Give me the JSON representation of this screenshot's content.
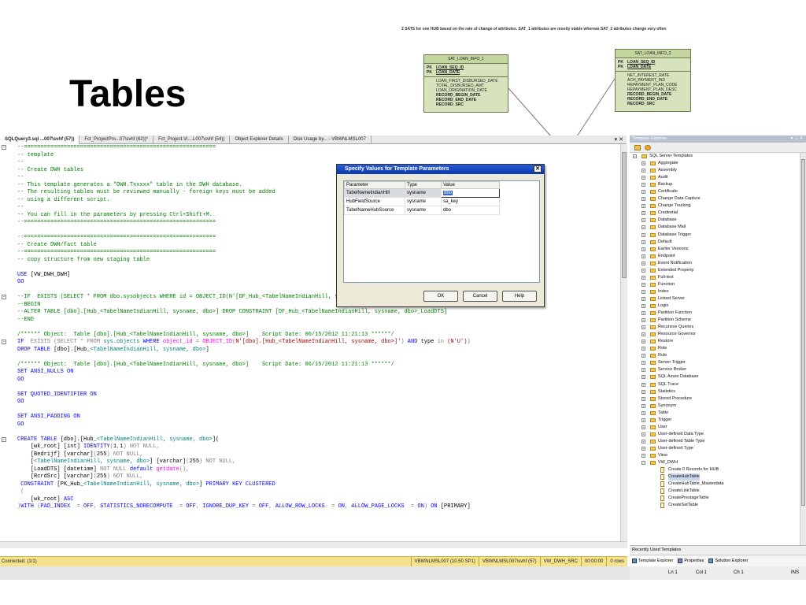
{
  "slide": {
    "title": "Tables",
    "note": "2 SATS for one HUB based on the rate of change of attributes. SAT_1 attributes are mostly stable whereas SAT_2 attributes change very often"
  },
  "entities": [
    {
      "name": "SAT_LOAN_INFO_1",
      "keys": [
        {
          "pk": "PK",
          "col": "LOAN_SEQ_ID"
        },
        {
          "pk": "PK",
          "col": "LOAN_DATE"
        }
      ],
      "cols": [
        "LOAN_FIRST_DISBURSED_DATE",
        "TOTAL_DISBURSED_AMT",
        "LOAN_ORIGINATION_DATE"
      ],
      "bold_cols": [
        "RECORD_BEGIN_DATE",
        "RECORD_END_DATE",
        "RECORD_SRC"
      ]
    },
    {
      "name": "SAT_LOAN_INFO_2",
      "keys": [
        {
          "pk": "PK",
          "col": "LOAN_SEQ_ID"
        },
        {
          "pk": "PK",
          "col": "LOAN_DATE"
        }
      ],
      "cols": [
        "NET_INTEREST_RATE",
        "ACH_PAYMENT_IND",
        "REPAYMENT_PLAN_CODE",
        "REPAYMENT_PLAN_DESC"
      ],
      "bold_cols": [
        "RECORD_BEGIN_DATE",
        "RECORD_END_DATE",
        "RECORD_SRC"
      ]
    }
  ],
  "tabs": [
    "SQLQuery3.sql ...007\\svhf (57))",
    "Fct_ProjectPro...07\\svhf (62))*",
    "Fct_Project.Vi....L007\\svhf (54))",
    "Object Explorer Details",
    "Disk Usage by... - VBWNLMSL007"
  ],
  "tabbar_ctrl": "▾ ✕",
  "code": [
    {
      "m": "⊟",
      "segs": [
        [
          "g",
          "--=========================================================="
        ]
      ]
    },
    {
      "segs": [
        [
          "g",
          "-- template"
        ]
      ]
    },
    {
      "segs": [
        [
          "g",
          "--"
        ]
      ]
    },
    {
      "segs": [
        [
          "g",
          "-- Create DWH tables"
        ]
      ]
    },
    {
      "segs": [
        [
          "g",
          "--"
        ]
      ]
    },
    {
      "segs": [
        [
          "g",
          "-- This template generates a \"DWH.Txxxxx\" table in the DWH database."
        ]
      ]
    },
    {
      "segs": [
        [
          "g",
          "-- The resulting tables must be reviewed manually - foreign keys must be added"
        ]
      ]
    },
    {
      "segs": [
        [
          "g",
          "-- using a different script."
        ]
      ]
    },
    {
      "segs": [
        [
          "g",
          "--"
        ]
      ]
    },
    {
      "segs": [
        [
          "g",
          "-- You can fill in the parameters by pressing Ctrl+Shift+M."
        ]
      ]
    },
    {
      "segs": [
        [
          "g",
          "--=========================================================="
        ]
      ]
    },
    {
      "segs": [
        [
          "k",
          ""
        ]
      ]
    },
    {
      "segs": [
        [
          "g",
          "--=========================================================="
        ]
      ]
    },
    {
      "segs": [
        [
          "g",
          "-- Create DWH/fact table"
        ]
      ]
    },
    {
      "segs": [
        [
          "g",
          "--=========================================================="
        ]
      ]
    },
    {
      "segs": [
        [
          "g",
          "-- copy structure from new staging table"
        ]
      ]
    },
    {
      "segs": [
        [
          "k",
          ""
        ]
      ]
    },
    {
      "segs": [
        [
          "b",
          "USE "
        ],
        [
          "k",
          "[VW_DWH_DWH]"
        ]
      ]
    },
    {
      "segs": [
        [
          "b",
          "GO"
        ]
      ]
    },
    {
      "segs": [
        [
          "k",
          ""
        ]
      ]
    },
    {
      "m": "⊟",
      "segs": [
        [
          "g",
          "--IF  EXISTS (SELECT * FROM dbo.sysobjects WHERE id = OBJECT_ID(N'[DF_Hub_<TabelNameIndianHill, sysname, dbo>_LoadDTS]') AND type = 'D')"
        ]
      ]
    },
    {
      "segs": [
        [
          "g",
          "--BEGIN"
        ]
      ]
    },
    {
      "segs": [
        [
          "g",
          "--ALTER TABLE [dbo].[Hub_<TabelNameIndianHill, sysname, dbo>] DROP CONSTRAINT [DF_Hub_<TabelNameIndianHill, sysname, dbo>_LoadDTS]"
        ]
      ]
    },
    {
      "segs": [
        [
          "g",
          "--END"
        ]
      ]
    },
    {
      "segs": [
        [
          "k",
          ""
        ]
      ]
    },
    {
      "segs": [
        [
          "g",
          "/****** Object:  Table [dbo].[Hub_<TabelNameIndianHill, sysname, dbo>]    Script Date: 06/15/2012 11:21:13 ******/"
        ]
      ]
    },
    {
      "m": "⊟",
      "segs": [
        [
          "b",
          "IF  "
        ],
        [
          "x",
          "EXISTS "
        ],
        [
          "x",
          "(SELECT * FROM "
        ],
        [
          "t",
          "sys.objects "
        ],
        [
          "b",
          "WHERE "
        ],
        [
          "m",
          "object_id "
        ],
        [
          "x",
          "= "
        ],
        [
          "m",
          "OBJECT_ID"
        ],
        [
          "x",
          "("
        ],
        [
          "r",
          "N'[dbo].[Hub_<TabelNameIndianHill, sysname, dbo>]'"
        ],
        [
          "x",
          ") "
        ],
        [
          "b",
          "AND "
        ],
        [
          "k",
          "type "
        ],
        [
          "x",
          "in "
        ],
        [
          "r",
          "(N'U')"
        ],
        [
          "x",
          ")"
        ]
      ]
    },
    {
      "segs": [
        [
          "b",
          "DROP TABLE "
        ],
        [
          "k",
          "[dbo].[Hub_"
        ],
        [
          "t",
          "<TabelNameIndianHill, sysname, dbo>"
        ],
        [
          "k",
          "]"
        ]
      ]
    },
    {
      "segs": [
        [
          "k",
          ""
        ]
      ]
    },
    {
      "segs": [
        [
          "g",
          "/****** Object:  Table [dbo].[Hub_<TabelNameIndianHill, sysname, dbo>]    Script Date: 06/15/2012 11:21:13 ******/"
        ]
      ]
    },
    {
      "segs": [
        [
          "b",
          "SET ANSI_NULLS ON"
        ]
      ]
    },
    {
      "segs": [
        [
          "b",
          "GO"
        ]
      ]
    },
    {
      "segs": [
        [
          "k",
          ""
        ]
      ]
    },
    {
      "segs": [
        [
          "b",
          "SET QUOTED_IDENTIFIER ON"
        ]
      ]
    },
    {
      "segs": [
        [
          "b",
          "GO"
        ]
      ]
    },
    {
      "segs": [
        [
          "k",
          ""
        ]
      ]
    },
    {
      "segs": [
        [
          "b",
          "SET ANSI_PADDING ON"
        ]
      ]
    },
    {
      "segs": [
        [
          "b",
          "GO"
        ]
      ]
    },
    {
      "segs": [
        [
          "k",
          ""
        ]
      ]
    },
    {
      "m": "⊟",
      "segs": [
        [
          "b",
          "CREATE TABLE "
        ],
        [
          "k",
          "[dbo].[Hub_"
        ],
        [
          "t",
          "<TabelNameIndianHill, sysname, dbo>"
        ],
        [
          "k",
          "]("
        ]
      ]
    },
    {
      "segs": [
        [
          "k",
          "    [wk_root] "
        ],
        [
          "k",
          "[int] "
        ],
        [
          "b",
          "IDENTITY"
        ],
        [
          "x",
          "("
        ],
        [
          "k",
          "1"
        ],
        [
          "x",
          ","
        ],
        [
          "k",
          "1"
        ],
        [
          "x",
          ") NOT NULL,"
        ]
      ]
    },
    {
      "segs": [
        [
          "k",
          "    [Bedrijf] "
        ],
        [
          "k",
          "[varchar]"
        ],
        [
          "x",
          "("
        ],
        [
          "k",
          "255"
        ],
        [
          "x",
          ") NOT NULL,"
        ]
      ]
    },
    {
      "segs": [
        [
          "k",
          "    ["
        ],
        [
          "t",
          "<TabelNameIndianHill, sysname, dbo>"
        ],
        [
          "k",
          "] [varchar]"
        ],
        [
          "x",
          "("
        ],
        [
          "k",
          "255"
        ],
        [
          "x",
          ") NOT NULL,"
        ]
      ]
    },
    {
      "segs": [
        [
          "k",
          "    [LoadDTS] [datetime] "
        ],
        [
          "x",
          "NOT NULL "
        ],
        [
          "b",
          "default "
        ],
        [
          "m",
          "getdate"
        ],
        [
          "x",
          "(),"
        ]
      ]
    },
    {
      "segs": [
        [
          "k",
          "    [RcrdSrc] [varchar]"
        ],
        [
          "x",
          "("
        ],
        [
          "k",
          "255"
        ],
        [
          "x",
          ") NOT NULL,"
        ]
      ]
    },
    {
      "segs": [
        [
          "b",
          " CONSTRAINT "
        ],
        [
          "k",
          "[PK_Hub_"
        ],
        [
          "t",
          "<TabelNameIndianHill, sysname, dbo>"
        ],
        [
          "k",
          "] "
        ],
        [
          "b",
          "PRIMARY KEY CLUSTERED"
        ]
      ]
    },
    {
      "segs": [
        [
          "x",
          " ("
        ]
      ]
    },
    {
      "segs": [
        [
          "k",
          "    [wk_root] "
        ],
        [
          "b",
          "ASC"
        ]
      ]
    },
    {
      "segs": [
        [
          "x",
          ")"
        ],
        [
          "b",
          "WITH "
        ],
        [
          "x",
          "("
        ],
        [
          "b",
          "PAD_INDEX  "
        ],
        [
          "x",
          "= "
        ],
        [
          "b",
          "OFF"
        ],
        [
          "x",
          ", "
        ],
        [
          "b",
          "STATISTICS_NORECOMPUTE  "
        ],
        [
          "x",
          "= "
        ],
        [
          "b",
          "OFF"
        ],
        [
          "x",
          ", "
        ],
        [
          "b",
          "IGNORE_DUP_KEY "
        ],
        [
          "x",
          "= "
        ],
        [
          "b",
          "OFF"
        ],
        [
          "x",
          ", "
        ],
        [
          "b",
          "ALLOW_ROW_LOCKS  "
        ],
        [
          "x",
          "= "
        ],
        [
          "b",
          "ON"
        ],
        [
          "x",
          ", "
        ],
        [
          "b",
          "ALLOW_PAGE_LOCKS  "
        ],
        [
          "x",
          "= "
        ],
        [
          "b",
          "ON"
        ],
        [
          "x",
          ") "
        ],
        [
          "b",
          "ON "
        ],
        [
          "k",
          "[PRIMARY]"
        ]
      ]
    }
  ],
  "dialog": {
    "title": "Specify Values for Template Parameters",
    "headers": [
      "Parameter",
      "Type",
      "Value"
    ],
    "rows": [
      {
        "param": "TabelNameIndianHill",
        "type": "sysname",
        "value": "dbo"
      },
      {
        "param": "HubFieldSource",
        "type": "sysname",
        "value": "sa_key"
      },
      {
        "param": "TabelNameHubSource",
        "type": "sysname",
        "value": "dbo"
      }
    ],
    "ok": "OK",
    "cancel": "Cancel",
    "help": "Help"
  },
  "status": {
    "left": "Connected. (1/1)",
    "cells": [
      "VBWNLMSL007 (10.50 SP1)",
      "VBWNLMSL007\\svhf (57)",
      "VW_DWH_SRC",
      "00:00:00",
      "0 rows"
    ]
  },
  "template_explorer": {
    "title": "Template Explorer",
    "title_ctrl": "▾ ⊥ ✕",
    "root": "SQL Server Templates",
    "folders": [
      "Aggregate",
      "Assembly",
      "Audit",
      "Backup",
      "Certificate",
      "Change Data Capture",
      "Change Tracking",
      "Credential",
      "Database",
      "Database Mail",
      "Database Trigger",
      "Default",
      "Earlier Versions",
      "Endpoint",
      "Event Notification",
      "Extended Property",
      "Full-text",
      "Function",
      "Index",
      "Linked Server",
      "Login",
      "Partition Function",
      "Partition Scheme",
      "Recursive Queries",
      "Resource Governor",
      "Restore",
      "Role",
      "Rule",
      "Server Trigger",
      "Service Broker",
      "SQL Azure Database",
      "SQL Trace",
      "Statistics",
      "Stored Procedure",
      "Synonym",
      "Table",
      "Trigger",
      "User",
      "User-defined Data Type",
      "User-defined Table Type",
      "User-defined Type",
      "View"
    ],
    "open_folder": "VW_DWH",
    "files": [
      "Create 0 Records for HUB",
      "CreateHubTable",
      "CreateHubTable_Masterdata",
      "CreateLinkTable",
      "CreatePrestageTable",
      "CreateSatTable"
    ],
    "selected_file": "CreateHubTable",
    "recent": "Recently Used Templates",
    "bottom_tabs": [
      "Template Explorer",
      "Properties",
      "Solution Explorer"
    ]
  },
  "bottom_status": {
    "ln": "Ln 1",
    "col": "Col 1",
    "ch": "Ch 1",
    "ins": "INS"
  }
}
